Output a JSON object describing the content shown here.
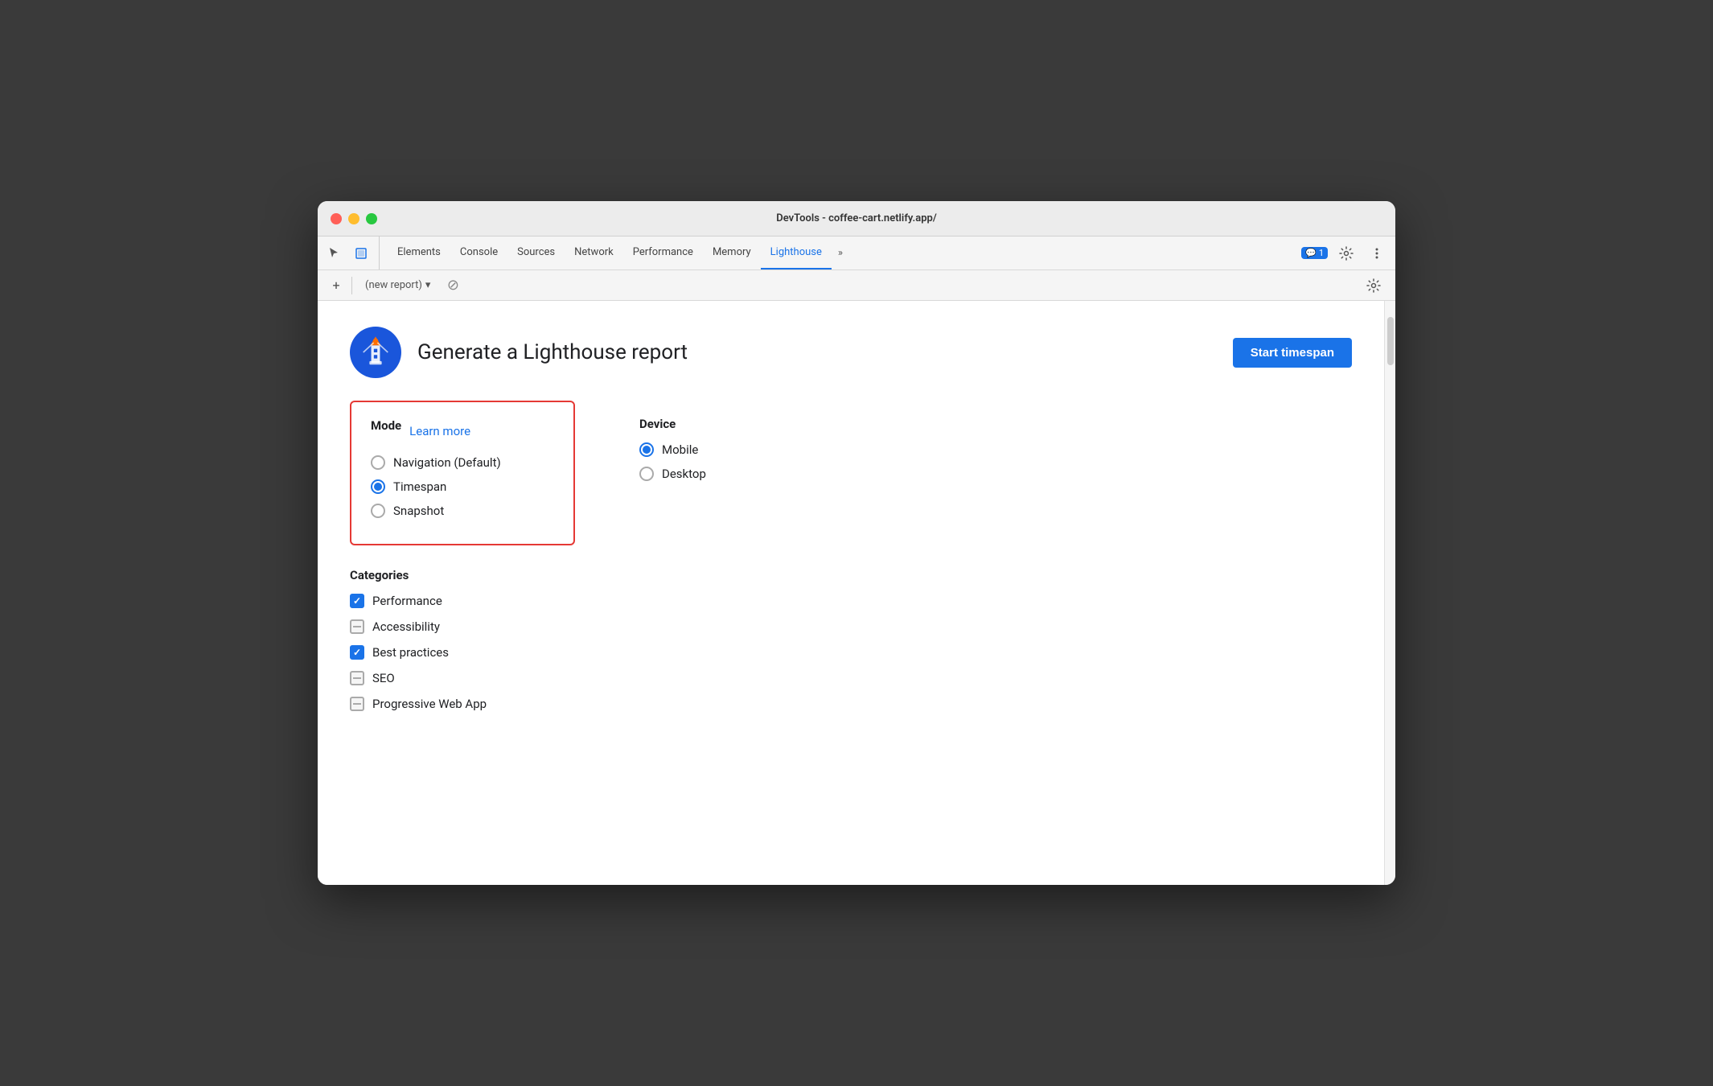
{
  "window": {
    "title": "DevTools - coffee-cart.netlify.app/"
  },
  "tabs": [
    {
      "label": "Elements",
      "active": false
    },
    {
      "label": "Console",
      "active": false
    },
    {
      "label": "Sources",
      "active": false
    },
    {
      "label": "Network",
      "active": false
    },
    {
      "label": "Performance",
      "active": false
    },
    {
      "label": "Memory",
      "active": false
    },
    {
      "label": "Lighthouse",
      "active": true
    }
  ],
  "tab_more": "»",
  "badge": {
    "icon": "💬",
    "count": "1"
  },
  "report_bar": {
    "new_report": "(new report)",
    "plus_icon": "+",
    "dropdown_icon": "▾",
    "cancel_icon": "⊘"
  },
  "header": {
    "title": "Generate a Lighthouse report",
    "start_button": "Start timespan"
  },
  "mode": {
    "title": "Mode",
    "learn_more": "Learn more",
    "options": [
      {
        "label": "Navigation (Default)",
        "selected": false
      },
      {
        "label": "Timespan",
        "selected": true
      },
      {
        "label": "Snapshot",
        "selected": false
      }
    ]
  },
  "device": {
    "title": "Device",
    "options": [
      {
        "label": "Mobile",
        "selected": true
      },
      {
        "label": "Desktop",
        "selected": false
      }
    ]
  },
  "categories": {
    "title": "Categories",
    "items": [
      {
        "label": "Performance",
        "state": "checked"
      },
      {
        "label": "Accessibility",
        "state": "indeterminate"
      },
      {
        "label": "Best practices",
        "state": "checked"
      },
      {
        "label": "SEO",
        "state": "indeterminate"
      },
      {
        "label": "Progressive Web App",
        "state": "indeterminate"
      }
    ]
  },
  "colors": {
    "active_tab": "#1a73e8",
    "start_button": "#1a73e8",
    "mode_border": "#e53935",
    "radio_selected": "#1a73e8",
    "checkbox_checked": "#1a73e8"
  }
}
